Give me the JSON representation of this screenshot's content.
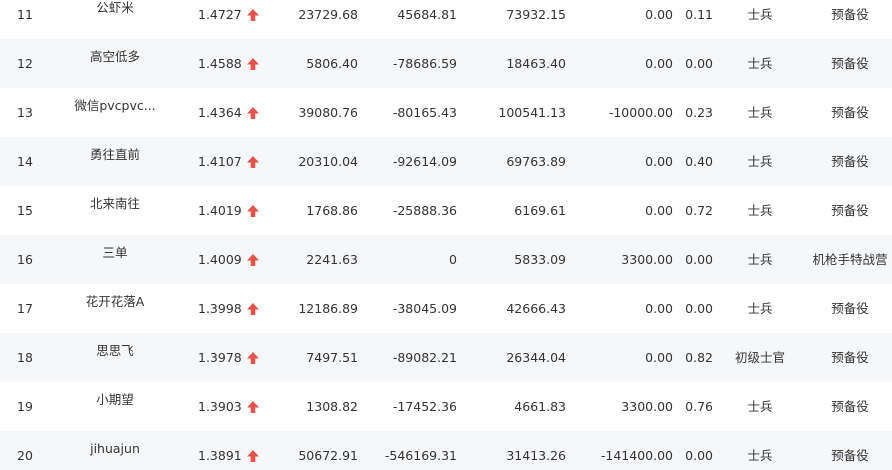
{
  "theme": {
    "arrow_color": "#e5534b",
    "alt_row_bg": "#f6f7f9"
  },
  "rows": [
    {
      "rank": "11",
      "name": "公虾米",
      "ratio": "1.4727",
      "trend_icon": "up-arrow-icon",
      "v1": "23729.68",
      "v2": "45684.81",
      "v3": "73932.15",
      "v4": "0.00",
      "v5": "0.11",
      "military_rank": "士兵",
      "status": "预备役"
    },
    {
      "rank": "12",
      "name": "高空低多",
      "ratio": "1.4588",
      "trend_icon": "up-arrow-icon",
      "v1": "5806.40",
      "v2": "-78686.59",
      "v3": "18463.40",
      "v4": "0.00",
      "v5": "0.00",
      "military_rank": "士兵",
      "status": "预备役"
    },
    {
      "rank": "13",
      "name": "微信pvcpvc...",
      "ratio": "1.4364",
      "trend_icon": "up-arrow-icon",
      "v1": "39080.76",
      "v2": "-80165.43",
      "v3": "100541.13",
      "v4": "-10000.00",
      "v5": "0.23",
      "military_rank": "士兵",
      "status": "预备役"
    },
    {
      "rank": "14",
      "name": "勇往直前",
      "ratio": "1.4107",
      "trend_icon": "up-arrow-icon",
      "v1": "20310.04",
      "v2": "-92614.09",
      "v3": "69763.89",
      "v4": "0.00",
      "v5": "0.40",
      "military_rank": "士兵",
      "status": "预备役"
    },
    {
      "rank": "15",
      "name": "北来南往",
      "ratio": "1.4019",
      "trend_icon": "up-arrow-icon",
      "v1": "1768.86",
      "v2": "-25888.36",
      "v3": "6169.61",
      "v4": "0.00",
      "v5": "0.72",
      "military_rank": "士兵",
      "status": "预备役"
    },
    {
      "rank": "16",
      "name": "三单",
      "ratio": "1.4009",
      "trend_icon": "up-arrow-icon",
      "v1": "2241.63",
      "v2": "0",
      "v3": "5833.09",
      "v4": "3300.00",
      "v5": "0.00",
      "military_rank": "士兵",
      "status": "机枪手特战营"
    },
    {
      "rank": "17",
      "name": "花开花落A",
      "ratio": "1.3998",
      "trend_icon": "up-arrow-icon",
      "v1": "12186.89",
      "v2": "-38045.09",
      "v3": "42666.43",
      "v4": "0.00",
      "v5": "0.00",
      "military_rank": "士兵",
      "status": "预备役"
    },
    {
      "rank": "18",
      "name": "思思飞",
      "ratio": "1.3978",
      "trend_icon": "up-arrow-icon",
      "v1": "7497.51",
      "v2": "-89082.21",
      "v3": "26344.04",
      "v4": "0.00",
      "v5": "0.82",
      "military_rank": "初级士官",
      "status": "预备役"
    },
    {
      "rank": "19",
      "name": "小期望",
      "ratio": "1.3903",
      "trend_icon": "up-arrow-icon",
      "v1": "1308.82",
      "v2": "-17452.36",
      "v3": "4661.83",
      "v4": "3300.00",
      "v5": "0.76",
      "military_rank": "士兵",
      "status": "预备役"
    },
    {
      "rank": "20",
      "name": "jihuajun",
      "ratio": "1.3891",
      "trend_icon": "up-arrow-icon",
      "v1": "50672.91",
      "v2": "-546169.31",
      "v3": "31413.26",
      "v4": "-141400.00",
      "v5": "0.00",
      "military_rank": "士兵",
      "status": "预备役"
    }
  ]
}
